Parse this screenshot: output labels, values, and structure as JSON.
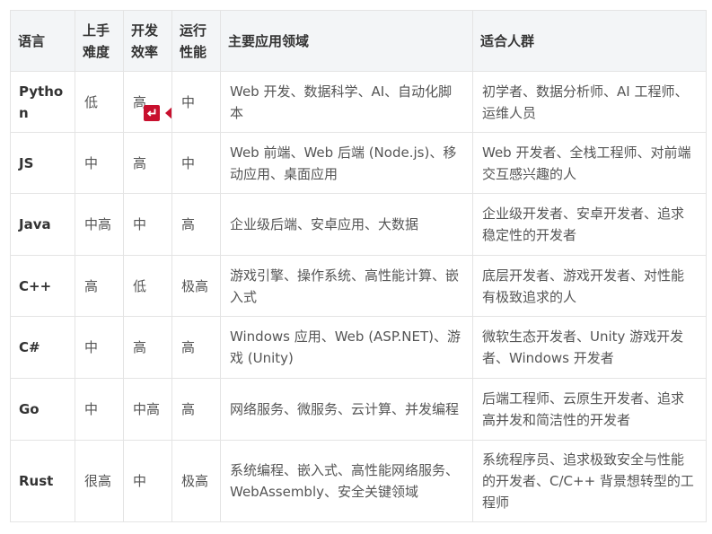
{
  "table": {
    "headers": {
      "lang": "语言",
      "difficulty": "上手难度",
      "efficiency": "开发效率",
      "performance": "运行性能",
      "applications": "主要应用领域",
      "audience": "适合人群"
    },
    "rows": [
      {
        "lang": "Python",
        "difficulty": "低",
        "efficiency": "高",
        "performance": "中",
        "applications": "Web 开发、数据科学、AI、自动化脚本",
        "audience": "初学者、数据分析师、AI 工程师、运维人员"
      },
      {
        "lang": "JS",
        "difficulty": "中",
        "efficiency": "高",
        "performance": "中",
        "applications": "Web 前端、Web 后端 (Node.js)、移动应用、桌面应用",
        "audience": "Web 开发者、全栈工程师、对前端交互感兴趣的人"
      },
      {
        "lang": "Java",
        "difficulty": "中高",
        "efficiency": "中",
        "performance": "高",
        "applications": "企业级后端、安卓应用、大数据",
        "audience": "企业级开发者、安卓开发者、追求稳定性的开发者"
      },
      {
        "lang": "C++",
        "difficulty": "高",
        "efficiency": "低",
        "performance": "极高",
        "applications": "游戏引擎、操作系统、高性能计算、嵌入式",
        "audience": "底层开发者、游戏开发者、对性能有极致追求的人"
      },
      {
        "lang": "C#",
        "difficulty": "中",
        "efficiency": "高",
        "performance": "高",
        "applications": "Windows 应用、Web (ASP.NET)、游戏 (Unity)",
        "audience": "微软生态开发者、Unity 游戏开发者、Windows 开发者"
      },
      {
        "lang": "Go",
        "difficulty": "中",
        "efficiency": "中高",
        "performance": "高",
        "applications": "网络服务、微服务、云计算、并发编程",
        "audience": "后端工程师、云原生开发者、追求高并发和简洁性的开发者"
      },
      {
        "lang": "Rust",
        "difficulty": "很高",
        "efficiency": "中",
        "performance": "极高",
        "applications": "系统编程、嵌入式、高性能网络服务、WebAssembly、安全关键领域",
        "audience": "系统程序员、追求极致安全与性能的开发者、C/C++ 背景想转型的工程师"
      }
    ]
  },
  "overlay": {
    "enter_icon": "enter-return-icon",
    "cursor_icon": "cursor-triangle-icon",
    "accent_color": "#c8102e"
  }
}
